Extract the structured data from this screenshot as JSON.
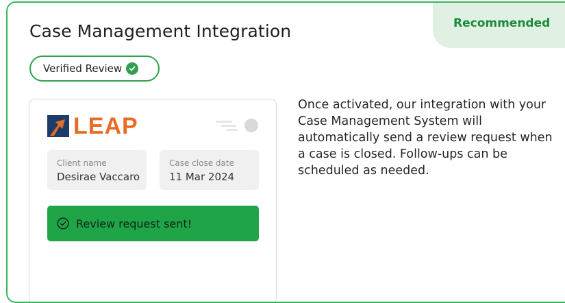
{
  "ribbon": {
    "label": "Recommended"
  },
  "title": "Case Management Integration",
  "badge": {
    "label": "Verified Review",
    "icon": "check-circle-icon"
  },
  "preview": {
    "logo_text": "LEAP",
    "toggle_icon": "toggle-icon",
    "client": {
      "label": "Client name",
      "value": "Desirae Vaccaro"
    },
    "close_date": {
      "label": "Case close date",
      "value": "11 Mar 2024"
    },
    "status": {
      "label": "Review request sent!",
      "icon": "check-circle-outline-icon"
    }
  },
  "description": "Once activated, our integration with your Case Management System will automatically send a review request when a case is closed. Follow-ups can be scheduled as needed.",
  "colors": {
    "border": "#3ab659",
    "ribbon_bg": "#e0f1e3",
    "ribbon_text": "#1c8a3c",
    "badge_green": "#2fa04e",
    "sent_bg": "#1fa548",
    "leap_orange": "#e86c25",
    "leap_navy": "#1d3d68"
  }
}
